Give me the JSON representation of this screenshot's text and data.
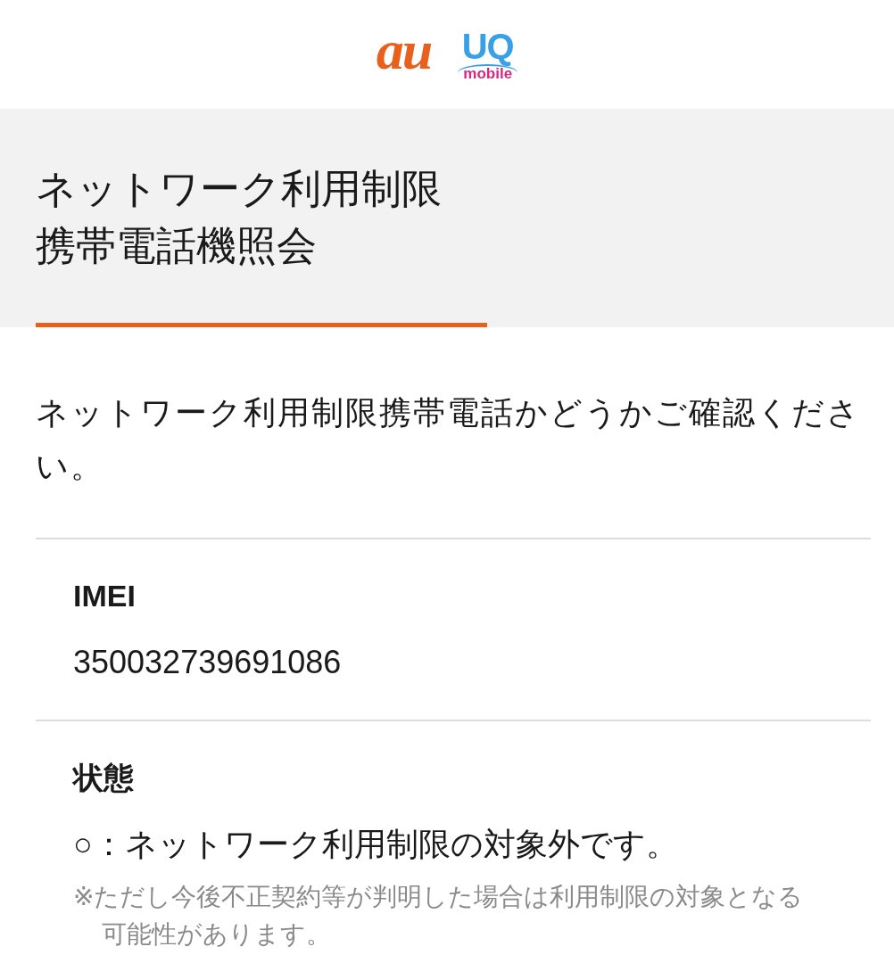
{
  "header": {
    "logo_au": "au",
    "logo_uq": "UQ",
    "logo_uq_sub": "mobile"
  },
  "page_title": [
    "ネットワーク利用制限",
    "携帯電話機照会"
  ],
  "description": "ネットワーク利用制限携帯電話かどうかご確認ください。",
  "fields": [
    {
      "label": "IMEI",
      "value": "350032739691086"
    },
    {
      "label": "状態",
      "value": "○：ネットワーク利用制限の対象外です。",
      "note": "※ただし今後不正契約等が判明した場合は利用制限の対象となる可能性があります。"
    }
  ]
}
